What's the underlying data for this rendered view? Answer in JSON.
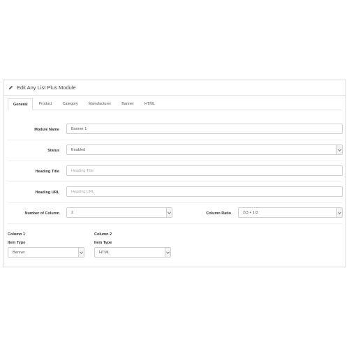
{
  "panel": {
    "title": "Edit Any List Plus Module",
    "pencil_icon": "pencil-icon"
  },
  "tabs": [
    {
      "label": "General",
      "active": true
    },
    {
      "label": "Product",
      "active": false
    },
    {
      "label": "Category",
      "active": false
    },
    {
      "label": "Manufacturer",
      "active": false
    },
    {
      "label": "Banner",
      "active": false
    },
    {
      "label": "HTML",
      "active": false
    }
  ],
  "form": {
    "module_name": {
      "label": "Module Name",
      "value": "Banner 1"
    },
    "status": {
      "label": "Status",
      "value": "Enabled"
    },
    "heading_title": {
      "label": "Heading Title",
      "placeholder": "Heading Title"
    },
    "heading_url": {
      "label": "Heading URL",
      "placeholder": "Heading URL"
    },
    "number_of_column": {
      "label": "Number of Column",
      "value": "2"
    },
    "column_ratio": {
      "label": "Column Ratio",
      "value": "2/3 + 1/3"
    }
  },
  "columns": [
    {
      "title": "Column 1",
      "item_type_label": "Item Type",
      "item_type_value": "Banner"
    },
    {
      "title": "Column 2",
      "item_type_label": "Item Type",
      "item_type_value": "HTML"
    }
  ]
}
